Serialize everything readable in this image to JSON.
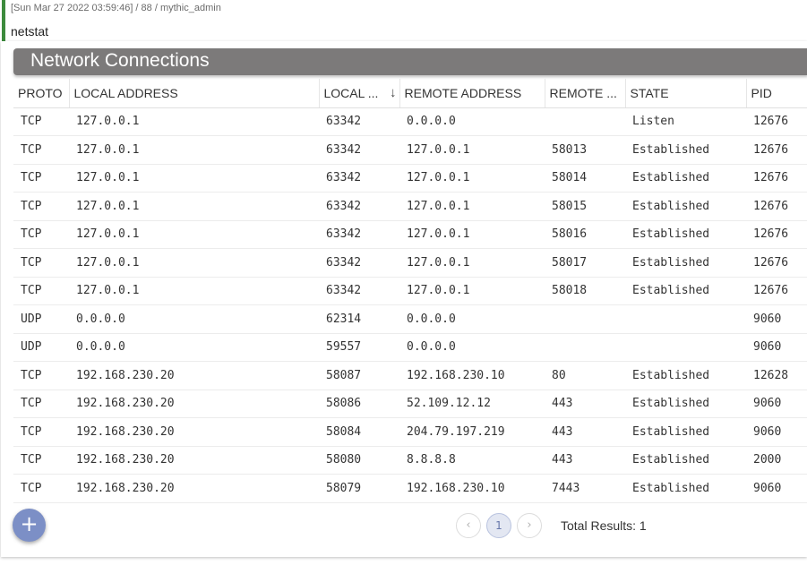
{
  "task": {
    "meta": "[Sun Mar 27 2022 03:59:46] / 88 / mythic_admin",
    "command": "netstat"
  },
  "panel": {
    "title": "Network Connections"
  },
  "table": {
    "columns": [
      {
        "label": "PROTO"
      },
      {
        "label": "LOCAL ADDRESS"
      },
      {
        "label": "LOCAL ..."
      },
      {
        "label": "REMOTE ADDRESS"
      },
      {
        "label": "REMOTE ..."
      },
      {
        "label": "STATE"
      },
      {
        "label": "PID"
      }
    ],
    "sort_icon": "arrow-down-icon",
    "rows": [
      [
        "TCP",
        "127.0.0.1",
        "63342",
        "0.0.0.0",
        "",
        "Listen",
        "12676"
      ],
      [
        "TCP",
        "127.0.0.1",
        "63342",
        "127.0.0.1",
        "58013",
        "Established",
        "12676"
      ],
      [
        "TCP",
        "127.0.0.1",
        "63342",
        "127.0.0.1",
        "58014",
        "Established",
        "12676"
      ],
      [
        "TCP",
        "127.0.0.1",
        "63342",
        "127.0.0.1",
        "58015",
        "Established",
        "12676"
      ],
      [
        "TCP",
        "127.0.0.1",
        "63342",
        "127.0.0.1",
        "58016",
        "Established",
        "12676"
      ],
      [
        "TCP",
        "127.0.0.1",
        "63342",
        "127.0.0.1",
        "58017",
        "Established",
        "12676"
      ],
      [
        "TCP",
        "127.0.0.1",
        "63342",
        "127.0.0.1",
        "58018",
        "Established",
        "12676"
      ],
      [
        "UDP",
        "0.0.0.0",
        "62314",
        "0.0.0.0",
        "",
        "",
        "9060"
      ],
      [
        "UDP",
        "0.0.0.0",
        "59557",
        "0.0.0.0",
        "",
        "",
        "9060"
      ],
      [
        "TCP",
        "192.168.230.20",
        "58087",
        "192.168.230.10",
        "80",
        "Established",
        "12628"
      ],
      [
        "TCP",
        "192.168.230.20",
        "58086",
        "52.109.12.12",
        "443",
        "Established",
        "9060"
      ],
      [
        "TCP",
        "192.168.230.20",
        "58084",
        "204.79.197.219",
        "443",
        "Established",
        "9060"
      ],
      [
        "TCP",
        "192.168.230.20",
        "58080",
        "8.8.8.8",
        "443",
        "Established",
        "2000"
      ],
      [
        "TCP",
        "192.168.230.20",
        "58079",
        "192.168.230.10",
        "7443",
        "Established",
        "9060"
      ]
    ]
  },
  "pagination": {
    "current_page": "1",
    "prev_icon": "chevron-left-icon",
    "next_icon": "chevron-right-icon",
    "total_label": "Total Results: 1"
  },
  "fab": {
    "icon": "plus-icon"
  },
  "colors": {
    "accent_bar": "#3d8b3d",
    "title_bar": "#7c7a7a",
    "fab": "#7c8fc6"
  }
}
